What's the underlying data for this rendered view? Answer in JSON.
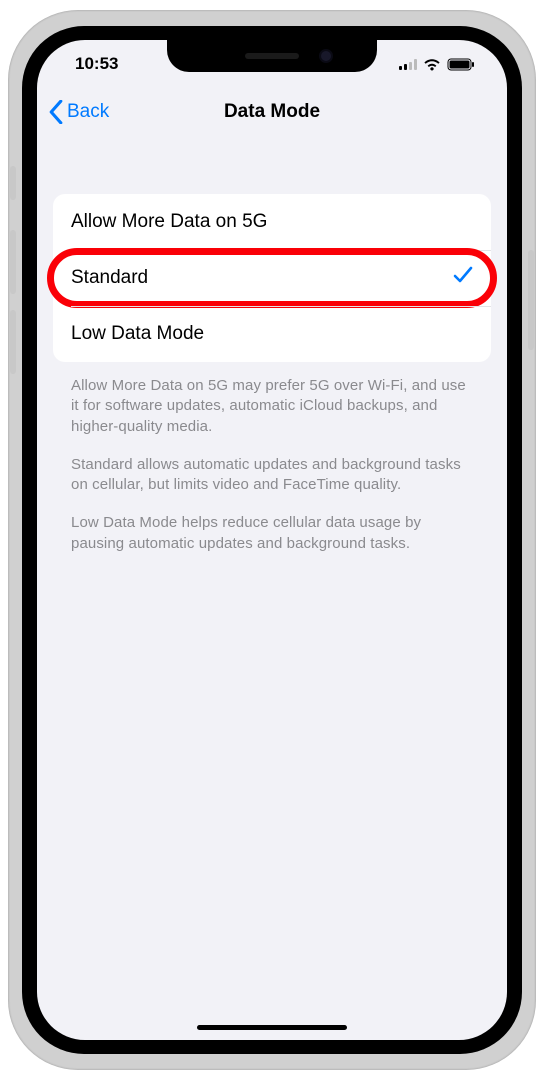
{
  "status": {
    "time": "10:53"
  },
  "nav": {
    "back_label": "Back",
    "title": "Data Mode"
  },
  "options": [
    {
      "label": "Allow More Data on 5G",
      "selected": false,
      "highlighted": false
    },
    {
      "label": "Standard",
      "selected": true,
      "highlighted": true
    },
    {
      "label": "Low Data Mode",
      "selected": false,
      "highlighted": false
    }
  ],
  "footer": {
    "p1": "Allow More Data on 5G may prefer 5G over Wi-Fi, and use it for software updates, automatic iCloud backups, and higher-quality media.",
    "p2": "Standard allows automatic updates and background tasks on cellular, but limits video and FaceTime quality.",
    "p3": "Low Data Mode helps reduce cellular data usage by pausing automatic updates and background tasks."
  }
}
